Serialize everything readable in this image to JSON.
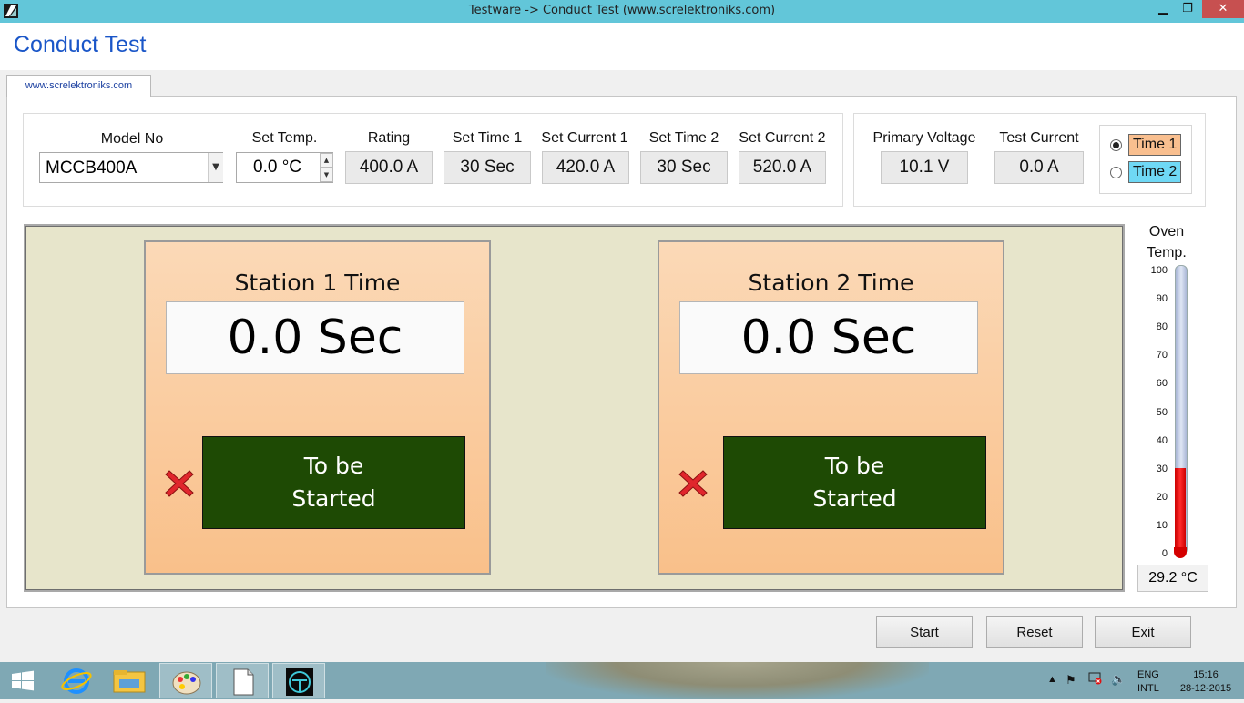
{
  "window": {
    "title": "Testware -> Conduct Test (www.screlektroniks.com)",
    "minimize_glyph": "▁",
    "maximize_glyph": "❐",
    "close_glyph": "✕"
  },
  "page_title": "Conduct Test",
  "tab_label": "www.screlektroniks.com",
  "settings": {
    "model_no": {
      "label": "Model No",
      "value": "MCCB400A"
    },
    "set_temp": {
      "label": "Set Temp.",
      "value": "0.0 °C"
    },
    "rating": {
      "label": "Rating",
      "value": "400.0 A"
    },
    "set_time_1": {
      "label": "Set Time 1",
      "value": "30 Sec"
    },
    "set_current_1": {
      "label": "Set Current 1",
      "value": "420.0 A"
    },
    "set_time_2": {
      "label": "Set Time 2",
      "value": "30 Sec"
    },
    "set_current_2": {
      "label": "Set Current 2",
      "value": "520.0 A"
    }
  },
  "readings": {
    "primary_voltage": {
      "label": "Primary Voltage",
      "value": "10.1 V"
    },
    "test_current": {
      "label": "Test Current",
      "value": "0.0 A"
    }
  },
  "time_select": {
    "options": [
      {
        "label": "Time 1",
        "selected": true,
        "color": "#f9bf8f"
      },
      {
        "label": "Time 2",
        "selected": false,
        "color": "#6fd8f5"
      }
    ]
  },
  "stations": [
    {
      "title": "Station 1 Time",
      "time": "0.0 Sec",
      "status": "To be\nStarted",
      "status_icon": "red-x-icon"
    },
    {
      "title": "Station 2 Time",
      "time": "0.0 Sec",
      "status": "To be\nStarted",
      "status_icon": "red-x-icon"
    }
  ],
  "oven": {
    "label_line1": "Oven",
    "label_line2": "Temp.",
    "ticks": [
      "100",
      "90",
      "80",
      "70",
      "60",
      "50",
      "40",
      "30",
      "20",
      "10",
      "0"
    ],
    "scale_max": 100,
    "level": 30,
    "value": "29.2 °C"
  },
  "buttons": {
    "start": "Start",
    "reset": "Reset",
    "exit": "Exit"
  },
  "taskbar": {
    "apps": [
      "windows-start-icon",
      "internet-explorer-icon",
      "file-explorer-icon",
      "paint-icon",
      "document-icon",
      "testware-icon"
    ],
    "lang_top": "ENG",
    "lang_bottom": "INTL",
    "time": "15:16",
    "date": "28-12-2015"
  },
  "colors": {
    "titlebar": "#62c6d9",
    "title_text": "#1a56c8",
    "station_status_bg": "#1e4a04",
    "thermometer_fill": "#e00000"
  }
}
